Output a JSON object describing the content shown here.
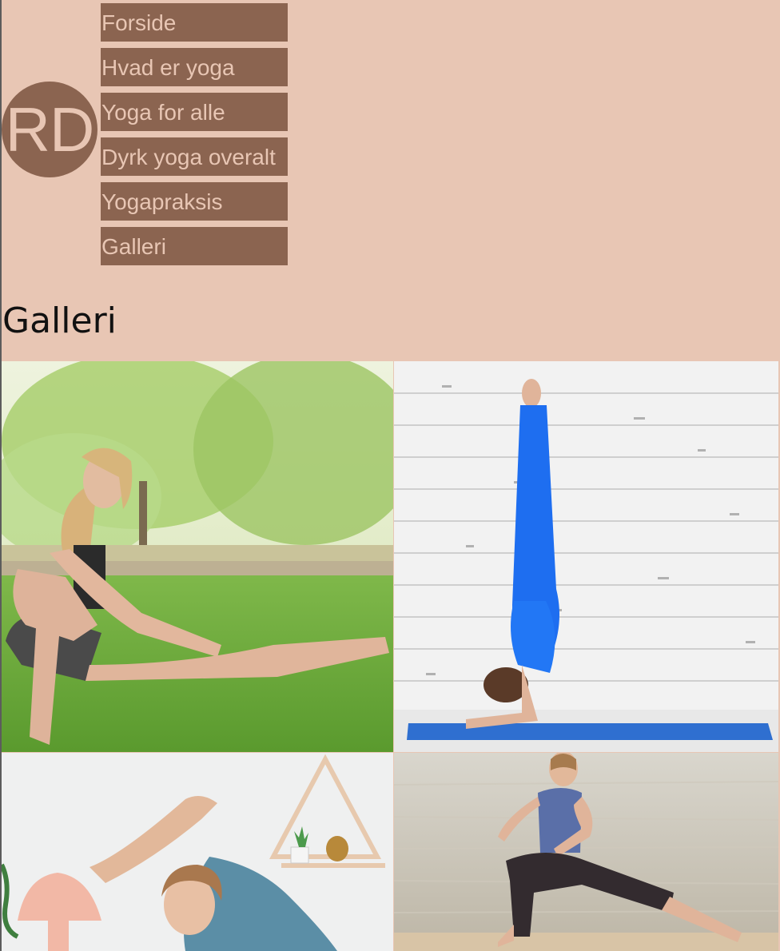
{
  "logo": {
    "text": "RD"
  },
  "nav": {
    "items": [
      {
        "label": "Forside"
      },
      {
        "label": "Hvad er yoga"
      },
      {
        "label": "Yoga for alle"
      },
      {
        "label": "Dyrk yoga overalt"
      },
      {
        "label": "Yogapraksis"
      },
      {
        "label": "Galleri"
      }
    ]
  },
  "page": {
    "title": "Galleri"
  },
  "gallery": {
    "images": [
      {
        "subject": "woman-arm-balance-on-grass"
      },
      {
        "subject": "woman-forearm-stand-against-brick-wall"
      },
      {
        "subject": "woman-side-stretch-indoors"
      },
      {
        "subject": "woman-lunge-by-water"
      }
    ]
  },
  "colors": {
    "background": "#e8c6b4",
    "accent": "#8b6450",
    "accent_text": "#e8c6b4"
  }
}
